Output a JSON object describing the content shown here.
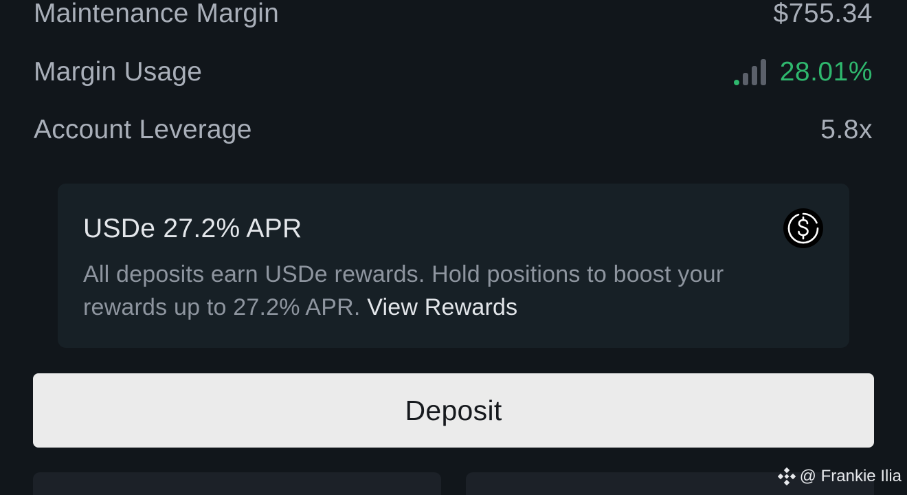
{
  "stats": {
    "maintenance_margin": {
      "label": "Maintenance Margin",
      "value": "$755.34"
    },
    "margin_usage": {
      "label": "Margin Usage",
      "value": "28.01%",
      "signal_level": 1,
      "signal_max": 4,
      "color": "#2fb86e"
    },
    "account_leverage": {
      "label": "Account Leverage",
      "value": "5.8x"
    }
  },
  "promo": {
    "title": "USDe 27.2% APR",
    "body": "All deposits earn USDe rewards. Hold positions to boost your rewards up to 27.2% APR.",
    "link_label": "View Rewards",
    "icon": "dollar-coin-icon"
  },
  "actions": {
    "deposit_label": "Deposit"
  },
  "watermark": {
    "text": "@ Frankie Ilia",
    "icon": "binance-logo-icon"
  },
  "colors": {
    "background": "#11161b",
    "card": "#172026",
    "positive": "#2fb86e",
    "button": "#ebebeb"
  }
}
